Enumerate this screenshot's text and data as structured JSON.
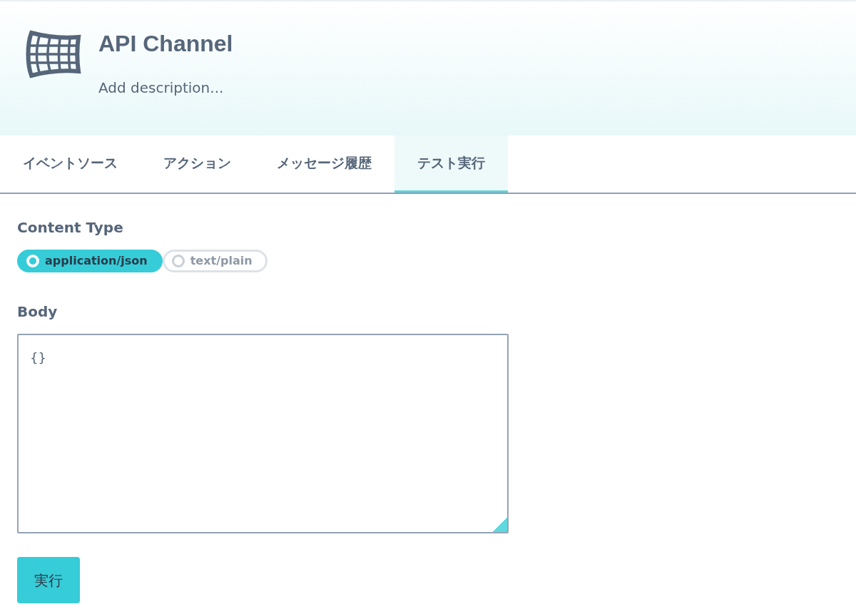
{
  "header": {
    "title": "API Channel",
    "description": "Add description..."
  },
  "tabs": [
    {
      "label": "イベントソース",
      "selected": false
    },
    {
      "label": "アクション",
      "selected": false
    },
    {
      "label": "メッセージ履歴",
      "selected": false
    },
    {
      "label": "テスト実行",
      "selected": true
    }
  ],
  "content_type": {
    "label": "Content Type",
    "options": [
      {
        "label": "application/json",
        "selected": true
      },
      {
        "label": "text/plain",
        "selected": false
      }
    ]
  },
  "body": {
    "label": "Body",
    "value": "{}"
  },
  "submit_button": "実行"
}
